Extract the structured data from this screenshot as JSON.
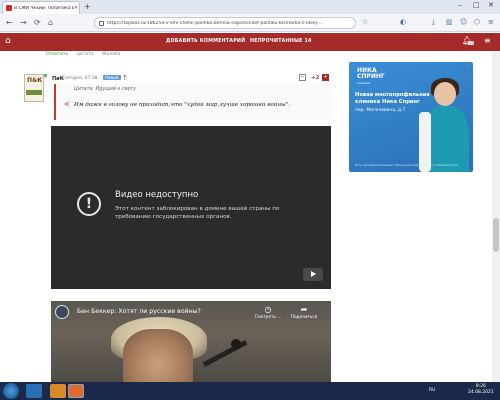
{
  "browser": {
    "tab_title": "В СМИ Чехии: Политика Берл",
    "url": "https://topwar.ru/186250-v-smi-chehii-politika-berlina-napominaet-politiku-bismarka-s-ideej-..."
  },
  "site_header": {
    "add_comment": "ДОБАВИТЬ КОММЕНТАРИЙ",
    "unread": "НЕПРОЧИТАННЫЕ 14",
    "notifications_count": "15"
  },
  "prev_comment_actions": [
    "Ответить",
    "Цитата",
    "Жалоба"
  ],
  "comment": {
    "avatar_text": "П&К",
    "author": "ПиК",
    "date": "Сегодня, 07:38",
    "badge": "Новый",
    "rating": "+2",
    "minus": "−",
    "plus": "+",
    "quote_source": "Цитата: Идущий к свету",
    "quote_mark": "«",
    "quote_text": "Им даже в голову не приходит,что \"худой мир,лучше хорошей войны\"."
  },
  "video_blocked": {
    "title": "Видео недоступно",
    "message": "Этот контент заблокирован в домене вашей страны по требованию государственных органов."
  },
  "video2": {
    "title": "Бен Беккер: Хотят ли русские войны?",
    "watch_later": "Смотреть ...",
    "share": "Поделиться"
  },
  "ad": {
    "logo_line1": "НИКА",
    "logo_line2": "СПРИНГ",
    "logo_tag": "клиника",
    "headline": "Новая многопрофильная клиника Ника Спринг",
    "address": "пер. Могилевича, д.7",
    "footer": "Есть противопоказания. Проконсультируйтесь со специалистом"
  },
  "taskbar": {
    "lang": "RU",
    "time": "8:26",
    "date": "24.08.2021"
  }
}
